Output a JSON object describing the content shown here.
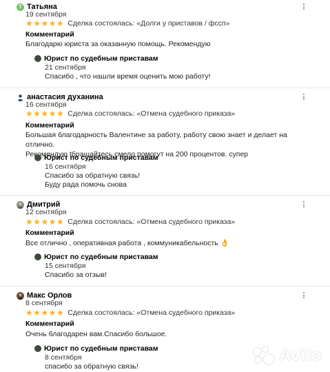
{
  "reviews": [
    {
      "author": "Татьяна",
      "avatar_letter": "Т",
      "avatar_color": "#79c26d",
      "date": "19 сентября",
      "stars": "★★★★★",
      "deal": "Сделка состоялась: «Долги у приставов / фссп»",
      "comment_label": "Комментарий",
      "comment": "Благодарю юриста за оказанную помощь. Рекомендую",
      "reply": {
        "name": "Юрист по судебным приставам",
        "date": "21 сентября",
        "text": "Спасибо , что нашли время оценить мою работу!"
      }
    },
    {
      "author": "анастасия духанина",
      "avatar_letter": "",
      "avatar_color": "#2c3e66",
      "date": "16 сентября",
      "stars": "★★★★★",
      "deal": "Сделка состоялась: «Отмена судебного приказа»",
      "comment_label": "Комментарий",
      "comment_line1": "Большая благодарность Валентине за работу, работу свою знает и делает на отлично.",
      "comment_line2": "Рекомендую tбращайтесь смело помогут на 200 процентов. супер",
      "reply": {
        "name": "Юрист по судебным приставам",
        "date": "16 сентября",
        "text_line1": "Спасибо за обратную связь!",
        "text_line2": "Буду рада помочь снова"
      }
    },
    {
      "author": "Дмитрий",
      "avatar_letter": "",
      "avatar_color": "#8a8f80",
      "date": "12 сентября",
      "stars": "★★★★★",
      "deal": "Сделка состоялась: «Отмена судебного приказа»",
      "comment_label": "Комментарий",
      "comment": "Все отлично , оперативная работа , коммуникабельность 👌",
      "reply": {
        "name": "Юрист по судебным приставам",
        "date": "15 сентября",
        "text": "Спасибо за отзыв!"
      }
    },
    {
      "author": "Макс Орлов",
      "avatar_letter": "",
      "avatar_color": "#6b4a3a",
      "date": "8 сентября",
      "stars": "★★★★★",
      "deal": "Сделка состоялась: «Отмена судебного приказа»",
      "comment_label": "Комментарий",
      "comment": "Очень благодарен вам.Спасибо большое.",
      "reply": {
        "name": "Юрист по судебным приставам",
        "date": "8 сентября",
        "text": "спасибо за обратную связь!"
      }
    }
  ],
  "watermark": "Avito"
}
